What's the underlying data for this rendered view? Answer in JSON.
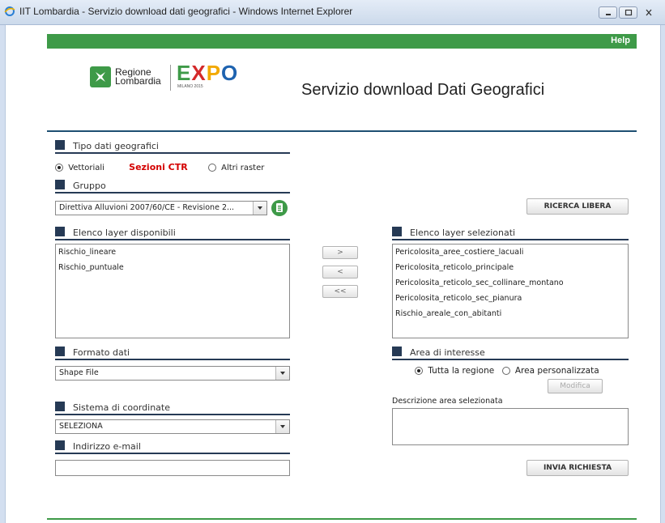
{
  "window": {
    "title": "IIT Lombardia - Servizio download dati geografici - Windows Internet Explorer"
  },
  "header": {
    "help": "Help",
    "logo_regione": [
      "Regione",
      "Lombardia"
    ],
    "logo_expo": "EXPO",
    "logo_expo_sub": "MILANO 2015",
    "page_title": "Servizio download Dati Geografici"
  },
  "tipo_dati": {
    "label": "Tipo dati geografici",
    "option_vettoriali": "Vettoriali",
    "sezioni_ctr": "Sezioni CTR",
    "option_altri_raster": "Altri raster",
    "selected": "Vettoriali"
  },
  "gruppo": {
    "label": "Gruppo",
    "selected": "Direttiva Alluvioni 2007/60/CE - Revisione 2..."
  },
  "ricerca_libera": "RICERCA LIBERA",
  "layer_disponibili": {
    "label": "Elenco layer disponibili",
    "items": [
      "Rischio_lineare",
      "Rischio_puntuale"
    ]
  },
  "transfer_buttons": {
    "add": ">",
    "remove": "<",
    "remove_all": "<<"
  },
  "layer_selezionati": {
    "label": "Elenco layer selezionati",
    "items": [
      "Pericolosita_aree_costiere_lacuali",
      "Pericolosita_reticolo_principale",
      "Pericolosita_reticolo_sec_collinare_montano",
      "Pericolosita_reticolo_sec_pianura",
      "Rischio_areale_con_abitanti"
    ]
  },
  "formato": {
    "label": "Formato dati",
    "selected": "Shape File"
  },
  "area": {
    "label": "Area di interesse",
    "option_tutta": "Tutta la regione",
    "option_personalizzata": "Area personalizzata",
    "selected": "Tutta la regione",
    "modifica": "Modifica",
    "descrizione_label": "Descrizione area selezionata",
    "descrizione_value": ""
  },
  "coordinate": {
    "label": "Sistema di coordinate",
    "selected": "SELEZIONA"
  },
  "email": {
    "label": "Indirizzo e-mail",
    "value": ""
  },
  "invia": "INVIA RICHIESTA",
  "colors": {
    "accent_green": "#3e9a48",
    "section_navy": "#263a55",
    "sezioni_red": "#d40000"
  }
}
